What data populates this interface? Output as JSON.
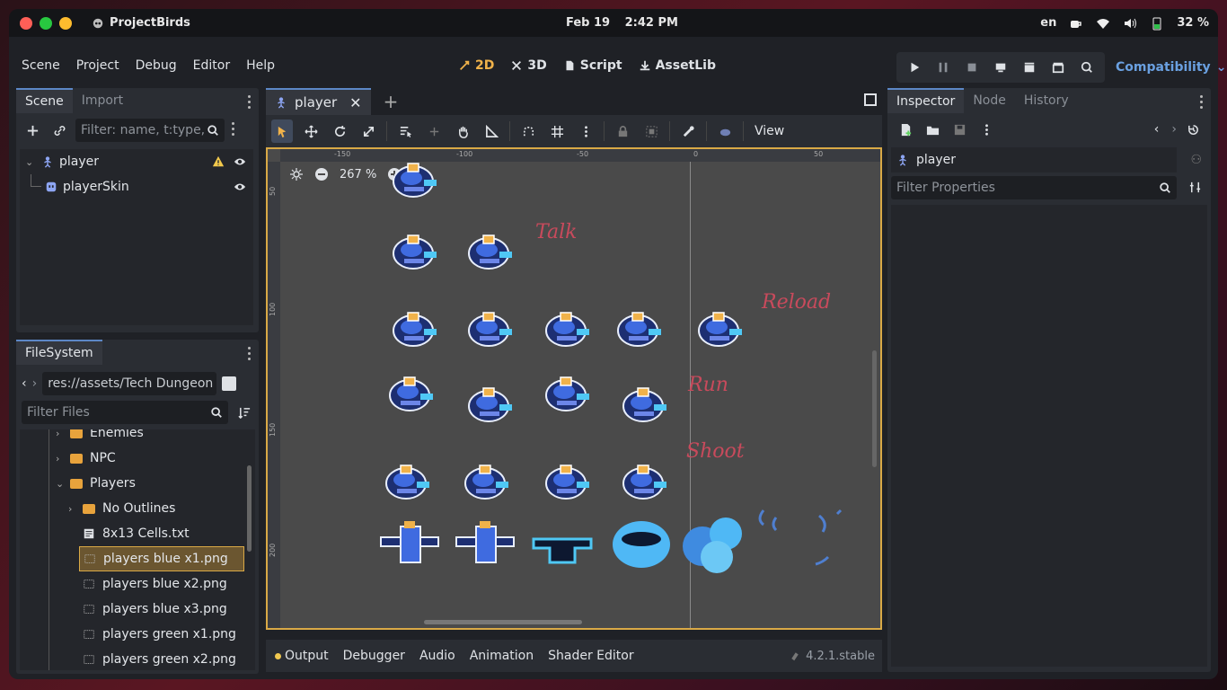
{
  "os_bar": {
    "app_name": "ProjectBirds",
    "date": "Feb 19",
    "time": "2:42 PM",
    "language": "en",
    "battery": "32 %"
  },
  "menus": [
    "Scene",
    "Project",
    "Debug",
    "Editor",
    "Help"
  ],
  "modes": [
    {
      "label": "2D",
      "icon": "2d-icon",
      "active": true
    },
    {
      "label": "3D",
      "icon": "3d-icon",
      "active": false
    },
    {
      "label": "Script",
      "icon": "script-icon",
      "active": false
    },
    {
      "label": "AssetLib",
      "icon": "assetlib-icon",
      "active": false
    }
  ],
  "renderer": "Compatibility",
  "scene_dock": {
    "tabs": [
      "Scene",
      "Import"
    ],
    "filter_placeholder": "Filter: name, t:type, g:group",
    "nodes": [
      {
        "name": "player",
        "icon": "character-body-icon",
        "warning": true
      },
      {
        "name": "playerSkin",
        "icon": "sprite-icon",
        "warning": false
      }
    ]
  },
  "filesystem": {
    "tab": "FileSystem",
    "path": "res://assets/Tech Dungeon Roguelite",
    "filter_placeholder": "Filter Files",
    "items": [
      {
        "name": "Enemies",
        "type": "folder",
        "depth": 1,
        "expanded": false
      },
      {
        "name": "NPC",
        "type": "folder",
        "depth": 1,
        "expanded": false
      },
      {
        "name": "Players",
        "type": "folder",
        "depth": 1,
        "expanded": true
      },
      {
        "name": "No Outlines",
        "type": "folder",
        "depth": 2,
        "expanded": false
      },
      {
        "name": "8x13 Cells.txt",
        "type": "text",
        "depth": 2
      },
      {
        "name": "players blue x1.png",
        "type": "image",
        "depth": 2,
        "selected": true
      },
      {
        "name": "players blue x2.png",
        "type": "image",
        "depth": 2
      },
      {
        "name": "players blue x3.png",
        "type": "image",
        "depth": 2
      },
      {
        "name": "players green x1.png",
        "type": "image",
        "depth": 2
      },
      {
        "name": "players green x2.png",
        "type": "image",
        "depth": 2
      }
    ]
  },
  "viewport": {
    "tab": "player",
    "zoom": "267 %",
    "view_menu": "View",
    "ruler_top": [
      "-150",
      "-100",
      "-50",
      "0",
      "50"
    ],
    "ruler_left": [
      "50",
      "100",
      "150",
      "200"
    ],
    "annotations": [
      "Talk",
      "Reload",
      "Run",
      "Shoot"
    ]
  },
  "bottom_tabs": [
    "Output",
    "Debugger",
    "Audio",
    "Animation",
    "Shader Editor"
  ],
  "version": "4.2.1.stable",
  "inspector": {
    "tabs": [
      "Inspector",
      "Node",
      "History"
    ],
    "node_name": "player",
    "filter_placeholder": "Filter Properties"
  }
}
